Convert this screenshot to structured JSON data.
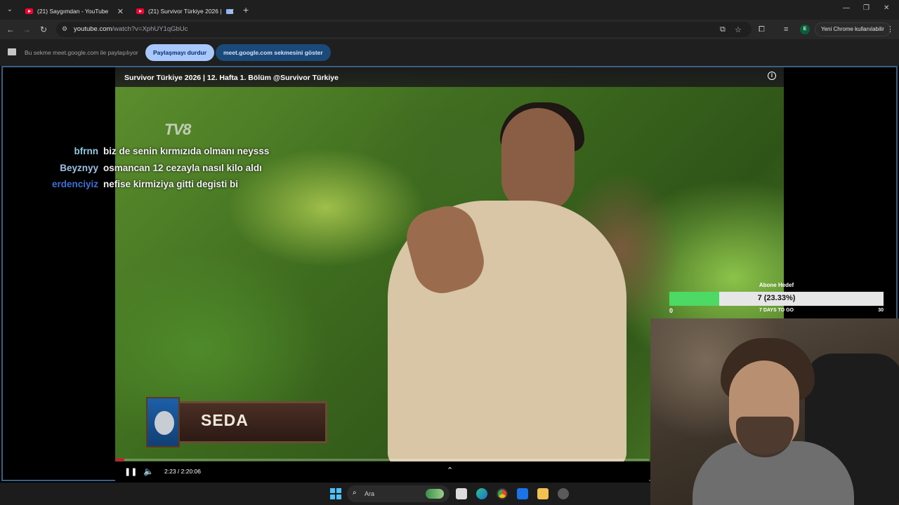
{
  "browser": {
    "tabs": [
      {
        "title": "(21) Saygımdan - YouTube"
      },
      {
        "title": "(21) Survivor Türkiye 2026 |"
      }
    ],
    "url_host": "youtube.com",
    "url_path": "/watch?v=XphUY1qGbUc",
    "profile_label": "Yeni Chrome kullanılabilir",
    "avatar_letter": "E"
  },
  "infobar": {
    "message": "Bu sekme meet.google.com ile paylaşılıyor",
    "stop_label": "Paylaşmayı durdur",
    "show_label": "meet.google.com sekmesini göster"
  },
  "video": {
    "title": "Survivor Türkiye 2026 | 12. Hafta 1. Bölüm @Survivor Türkiye",
    "channel_logo": "TV8",
    "nameplate": "SEDA",
    "time": "2:23 / 2:20:06",
    "progress": 0.017
  },
  "chat": [
    {
      "user": "bfrnn",
      "message": "biz de senin kırmızıda olmanı neysss",
      "color": "#8ecbe0"
    },
    {
      "user": "Beyznyy",
      "message": "osmancan 12 cezayla nasıl kilo aldı",
      "color": "#9ec1e6"
    },
    {
      "user": "erdenciyiz",
      "message": "nefise kirmiziya gitti degisti bi",
      "color": "#3d6fd6"
    }
  ],
  "goal": {
    "title": "Abone Hedef",
    "value_label": "7 (23.33%)",
    "fraction": 0.2333,
    "min": "0",
    "max": "30",
    "days_label": "7 DAYS TO GO"
  },
  "taskbar": {
    "search_label": "Ara"
  },
  "icons": {
    "tab_search": "chevron-down-icon",
    "back": "arrow-left-icon",
    "forward": "arrow-right-icon",
    "reload": "reload-icon"
  }
}
